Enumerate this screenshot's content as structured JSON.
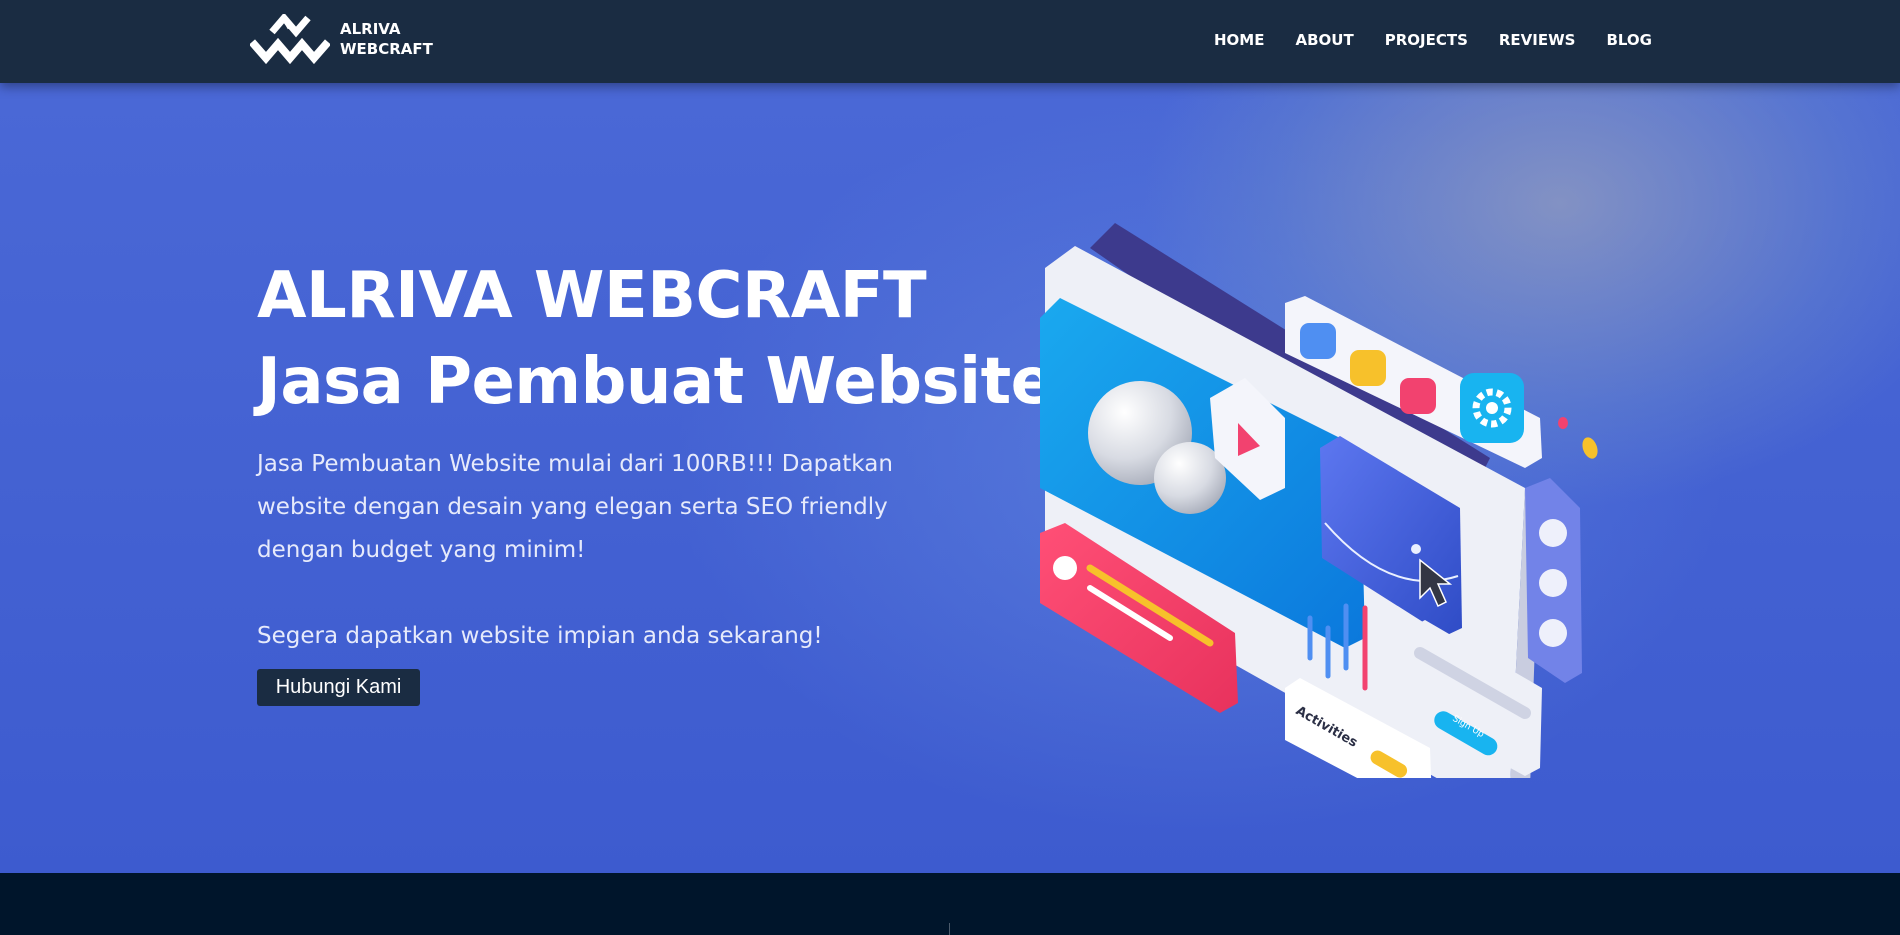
{
  "brand": {
    "line1": "ALRIVA",
    "line2": "WEBCRAFT",
    "icon": "alriva-logo-mark"
  },
  "nav": {
    "items": [
      {
        "label": "HOME"
      },
      {
        "label": "ABOUT"
      },
      {
        "label": "PROJECTS"
      },
      {
        "label": "REVIEWS"
      },
      {
        "label": "BLOG"
      }
    ]
  },
  "hero": {
    "title_line1": "ALRIVA WEBCRAFT",
    "title_line2": "Jasa Pembuat Website",
    "description": "Jasa Pembuatan Website mulai dari 100RB!!! Dapatkan website dengan desain yang elegan serta SEO friendly dengan budget yang minim!",
    "cta_text": "Segera dapatkan website impian anda sekarang!",
    "button_label": "Hubungi Kami"
  },
  "illustration": {
    "icon": "isometric-web-ui-illustration",
    "activities_label": "Activities",
    "signup_label": "Sign Up"
  },
  "colors": {
    "navbar": "#1a2c42",
    "hero_blue": "#4563d3",
    "button": "#1a2c42",
    "footer": "#00152b",
    "accent_pink": "#f2426f",
    "accent_cyan": "#18b4f0",
    "accent_yellow": "#f7c12b"
  }
}
